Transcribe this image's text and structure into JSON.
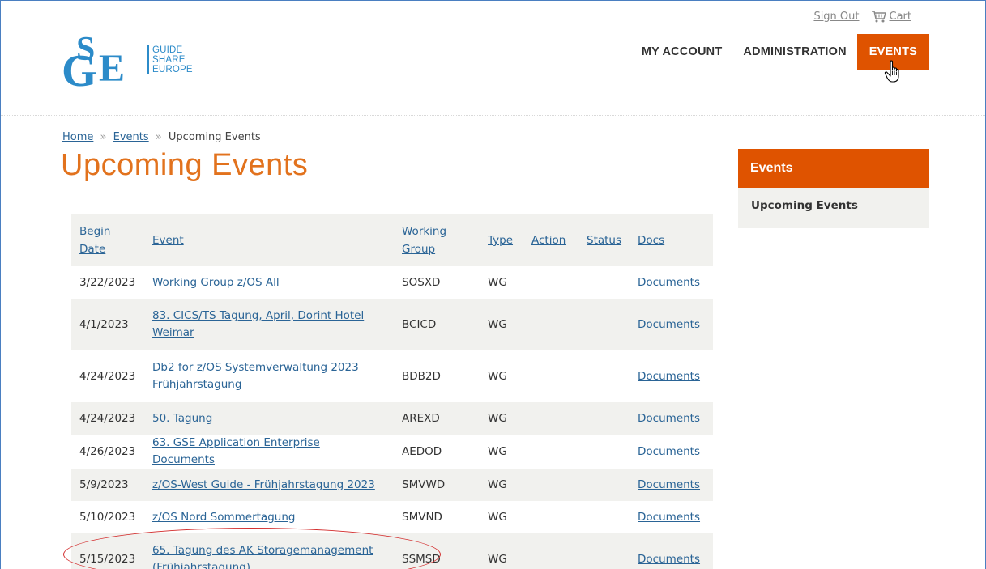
{
  "utility": {
    "sign_out": "Sign Out",
    "cart": "Cart"
  },
  "logo": {
    "mark": "GSE",
    "line1": "GUIDE",
    "line2": "SHARE",
    "line3": "EUROPE"
  },
  "nav": {
    "my_account": "MY ACCOUNT",
    "administration": "ADMINISTRATION",
    "events": "EVENTS"
  },
  "breadcrumb": {
    "home": "Home",
    "events": "Events",
    "current": "Upcoming Events",
    "separator": "»"
  },
  "page_title": "Upcoming Events",
  "table": {
    "headers": {
      "begin_line1": "Begin",
      "begin_line2": "Date",
      "event": "Event",
      "wg_line1": "Working",
      "wg_line2": "Group",
      "type": "Type",
      "action": "Action",
      "status": "Status",
      "docs": "Docs"
    },
    "rows": [
      {
        "date": "3/22/2023",
        "event_line1": "Working Group z/OS All",
        "event_line2": "",
        "group": "SOSXD",
        "type": "WG",
        "docs": "Documents"
      },
      {
        "date": "4/1/2023",
        "event_line1": "83. CICS/TS Tagung, April, Dorint Hotel",
        "event_line2": "Weimar",
        "group": "BCICD",
        "type": "WG",
        "docs": "Documents"
      },
      {
        "date": "4/24/2023",
        "event_line1": "Db2 for z/OS Systemverwaltung 2023",
        "event_line2": "Frühjahrstagung",
        "group": "BDB2D",
        "type": "WG",
        "docs": "Documents"
      },
      {
        "date": "4/24/2023",
        "event_line1": "50. Tagung",
        "event_line2": "",
        "group": "AREXD",
        "type": "WG",
        "docs": "Documents"
      },
      {
        "date": "4/26/2023",
        "event_line1": "63. GSE Application Enterprise Documents",
        "event_line2": "",
        "group": "AEDOD",
        "type": "WG",
        "docs": "Documents"
      },
      {
        "date": "5/9/2023",
        "event_line1": "z/OS-West Guide - Frühjahrstagung 2023",
        "event_line2": "",
        "group": "SMVWD",
        "type": "WG",
        "docs": "Documents"
      },
      {
        "date": "5/10/2023",
        "event_line1": "z/OS Nord Sommertagung",
        "event_line2": "",
        "group": "SMVND",
        "type": "WG",
        "docs": "Documents"
      },
      {
        "date": "5/15/2023",
        "event_line1": "65. Tagung des AK Storagemanagement",
        "event_line2": "(Frühjahrstagung)",
        "group": "SSMSD",
        "type": "WG",
        "docs": "Documents"
      }
    ]
  },
  "sidebar": {
    "header": "Events",
    "item": "Upcoming Events"
  },
  "colors": {
    "accent": "#df5300",
    "title": "#e2721d",
    "link": "#2a6496",
    "highlight_ellipse": "#d32f2f"
  }
}
